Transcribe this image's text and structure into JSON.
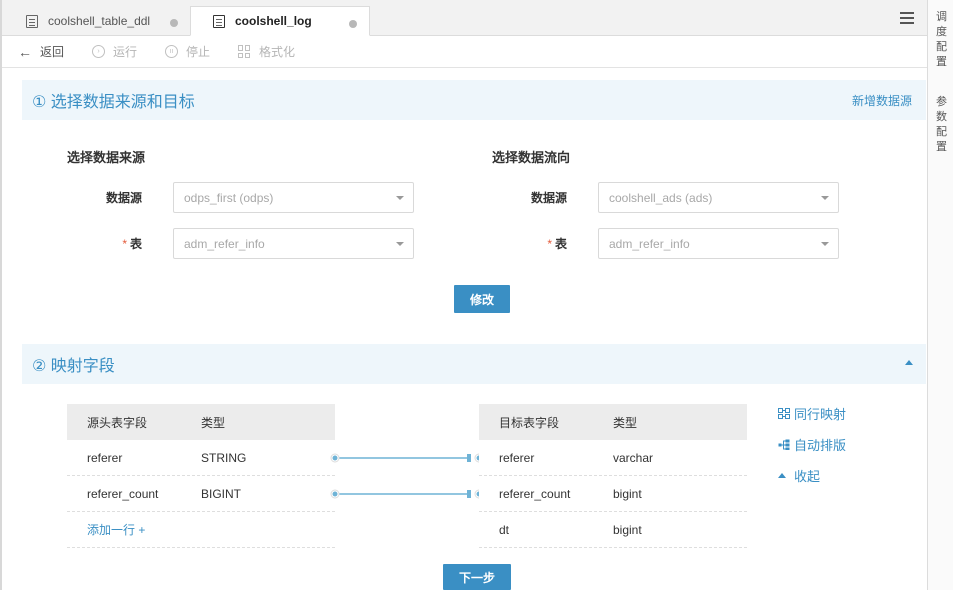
{
  "tabs": [
    {
      "label": "coolshell_table_ddl",
      "active": false
    },
    {
      "label": "coolshell_log",
      "active": true
    }
  ],
  "toolbar": {
    "back_label": "返回",
    "run_label": "运行",
    "stop_label": "停止",
    "format_label": "格式化"
  },
  "right_rail": {
    "schedule_config": "调度配置",
    "param_config": "参数配置"
  },
  "section1": {
    "title": "① 选择数据来源和目标",
    "add_source_link": "新增数据源",
    "source_title": "选择数据来源",
    "target_title": "选择数据流向",
    "datasource_label": "数据源",
    "table_label": "表",
    "required_mark": "*",
    "source_datasource_value": "odps_first (odps)",
    "source_table_value": "adm_refer_info",
    "target_datasource_value": "coolshell_ads (ads)",
    "target_table_value": "adm_refer_info",
    "modify_button": "修改"
  },
  "section2": {
    "title": "② 映射字段",
    "source_table": {
      "headers": [
        "源头表字段",
        "类型"
      ],
      "rows": [
        [
          "referer",
          "STRING"
        ],
        [
          "referer_count",
          "BIGINT"
        ]
      ],
      "add_row": "添加一行 +"
    },
    "target_table": {
      "headers": [
        "目标表字段",
        "类型"
      ],
      "rows": [
        [
          "referer",
          "varchar"
        ],
        [
          "referer_count",
          "bigint"
        ],
        [
          "dt",
          "bigint"
        ]
      ]
    },
    "actions": {
      "same_row_map": "同行映射",
      "auto_layout": "自动排版",
      "collapse": "收起"
    },
    "next_button": "下一步"
  },
  "colors": {
    "accent": "#3a8fc4",
    "section_bg": "#eef6fb",
    "required": "#e45b3b",
    "connector": "#6fb3d6"
  },
  "icons": [
    "file-table-icon",
    "menu-icon",
    "back-arrow-icon",
    "run-icon",
    "stop-icon",
    "format-icon",
    "caret-down-icon",
    "caret-up-icon",
    "map-icon",
    "layout-icon"
  ]
}
